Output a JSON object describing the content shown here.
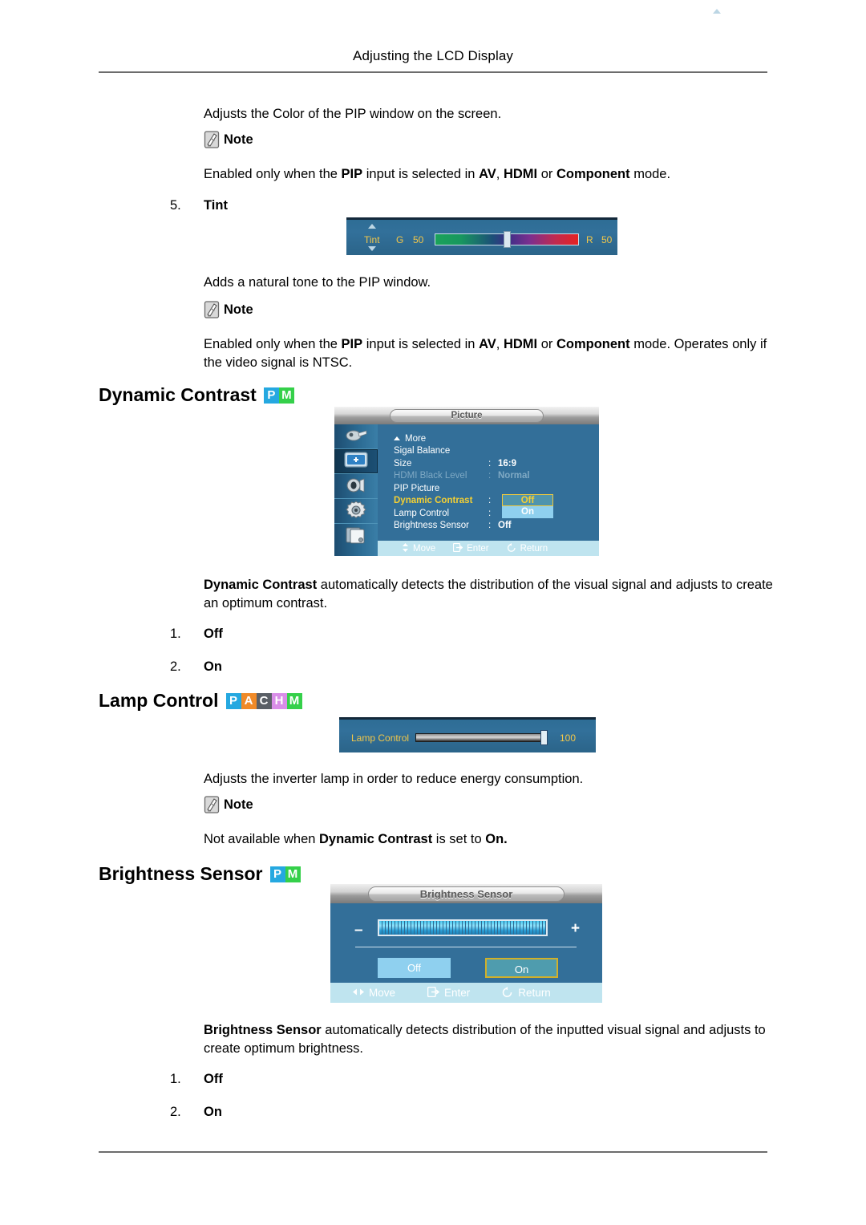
{
  "header": {
    "title": "Adjusting the LCD Display"
  },
  "note_label": "Note",
  "intro": {
    "pip_color_text": "Adjusts the Color of the PIP window on the screen.",
    "pip_color_note": "Enabled only when the PIP input is selected in AV, HDMI or Component mode."
  },
  "tint": {
    "number": "5.",
    "title": "Tint",
    "description": "Adds a natural tone to the PIP window.",
    "note": "Enabled only when the PIP input is selected in AV, HDMI or Component mode. Operates only if the video signal is NTSC.",
    "osd": {
      "label": "Tint",
      "left_letter": "G",
      "left_value": "50",
      "right_letter": "R",
      "right_value": "50"
    }
  },
  "dynamic_contrast": {
    "heading": "Dynamic Contrast",
    "badges": [
      "P",
      "M"
    ],
    "description_bold": "Dynamic Contrast",
    "description_rest": " automatically detects the distribution of the visual signal and adjusts to create an optimum contrast.",
    "options": [
      {
        "num": "1.",
        "label": "Off"
      },
      {
        "num": "2.",
        "label": "On"
      }
    ],
    "osd": {
      "title": "Picture",
      "sidebar_icons": [
        "input-source-icon",
        "picture-icon",
        "sound-icon",
        "setup-gear-icon",
        "multi-control-icon"
      ],
      "selected_sidebar_index": 1,
      "rows": [
        {
          "label": "More",
          "colon": "",
          "value": "",
          "state": "arrow"
        },
        {
          "label": "Sigal Balance",
          "colon": "",
          "value": "",
          "state": "normal"
        },
        {
          "label": "Size",
          "colon": ":",
          "value": "16:9",
          "state": "normal"
        },
        {
          "label": "HDMI Black Level",
          "colon": ":",
          "value": "Normal",
          "state": "dim"
        },
        {
          "label": "PIP Picture",
          "colon": "",
          "value": "",
          "state": "normal"
        },
        {
          "label": "Dynamic Contrast",
          "colon": ":",
          "value": "",
          "state": "selected"
        },
        {
          "label": "Lamp Control",
          "colon": ":",
          "value": "",
          "state": "normal"
        },
        {
          "label": "Brightness Sensor",
          "colon": ":",
          "value": "Off",
          "state": "normal"
        }
      ],
      "dropdown": {
        "selected": "Off",
        "other": "On"
      },
      "footer": [
        {
          "icon": "move-updown-icon",
          "label": "Move"
        },
        {
          "icon": "enter-icon",
          "label": "Enter"
        },
        {
          "icon": "return-icon",
          "label": "Return"
        }
      ]
    }
  },
  "lamp_control": {
    "heading": "Lamp Control",
    "badges": [
      "P",
      "A",
      "C",
      "H",
      "M"
    ],
    "description": "Adjusts the inverter lamp in order to reduce energy consumption.",
    "note_prefix": "Not available when ",
    "note_bold1": "Dynamic Contrast",
    "note_middle": " is set to ",
    "note_bold2": "On.",
    "osd": {
      "label": "Lamp Control",
      "value": "100"
    }
  },
  "brightness_sensor": {
    "heading": "Brightness Sensor",
    "badges": [
      "P",
      "M"
    ],
    "description_bold": "Brightness Sensor",
    "description_rest": " automatically detects distribution of the inputted visual signal and adjusts to create optimum brightness.",
    "options": [
      {
        "num": "1.",
        "label": "Off"
      },
      {
        "num": "2.",
        "label": "On"
      }
    ],
    "osd": {
      "title": "Brightness Sensor",
      "minus": "–",
      "plus": "+",
      "btn_off": "Off",
      "btn_on": "On",
      "footer": [
        {
          "icon": "move-leftright-icon",
          "label": "Move"
        },
        {
          "icon": "enter-icon",
          "label": "Enter"
        },
        {
          "icon": "return-icon",
          "label": "Return"
        }
      ]
    }
  },
  "colors": {
    "osd_blue": "#336f99",
    "osd_highlight_yellow": "#f5d033",
    "osd_footer": "#bfe4ef",
    "badge_p": "#25a8e0",
    "badge_a": "#f08a28",
    "badge_c": "#5a5f66",
    "badge_h": "#d98ee8",
    "badge_m": "#35d04a"
  }
}
